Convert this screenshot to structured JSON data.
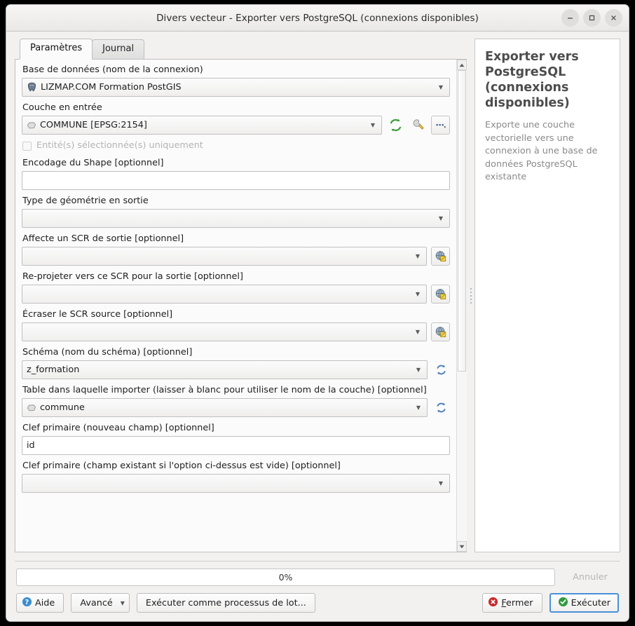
{
  "window": {
    "title": "Divers vecteur - Exporter vers PostgreSQL (connexions disponibles)",
    "minimize_label": "minimize-icon",
    "maximize_label": "maximize-icon",
    "close_label": "close-icon"
  },
  "tabs": [
    {
      "label": "Paramètres",
      "active": true
    },
    {
      "label": "Journal",
      "active": false
    }
  ],
  "form": {
    "database": {
      "label": "Base de données (nom de la connexion)",
      "value": "LIZMAP.COM Formation PostGIS",
      "icon": "postgresql-elephant-icon"
    },
    "input_layer": {
      "label": "Couche en entrée",
      "value": "COMMUNE [EPSG:2154]",
      "icon": "polygon-layer-icon",
      "buttons": [
        {
          "name": "iterate-icon",
          "glyph": "↻"
        },
        {
          "name": "wrench-icon",
          "glyph": "🔧"
        },
        {
          "name": "more-options-button",
          "label": "..."
        }
      ]
    },
    "selected_only": {
      "label": "Entité(s) sélectionnée(s) uniquement",
      "checked": false,
      "disabled": true
    },
    "shape_encoding": {
      "label": "Encodage du Shape [optionnel]",
      "value": ""
    },
    "geometry_type": {
      "label": "Type de géométrie en sortie",
      "value": ""
    },
    "assign_crs": {
      "label": "Affecte un SCR de sortie [optionnel]",
      "value": "",
      "button": "crs-select-icon"
    },
    "reproject_crs": {
      "label": "Re-projeter vers ce SCR pour la sortie [optionnel]",
      "value": "",
      "button": "crs-select-icon"
    },
    "override_crs": {
      "label": "Écraser le SCR source [optionnel]",
      "value": "",
      "button": "crs-select-icon"
    },
    "schema": {
      "label": "Schéma (nom du schéma) [optionnel]",
      "value": "z_formation",
      "button": "refresh-icon"
    },
    "table": {
      "label": "Table dans laquelle importer (laisser à blanc pour utiliser le nom de la couche) [optionnel]",
      "value": "commune",
      "icon": "polygon-layer-icon",
      "button": "refresh-icon"
    },
    "primary_key_new": {
      "label": "Clef primaire (nouveau champ) [optionnel]",
      "value": "id"
    },
    "primary_key_existing": {
      "label": "Clef primaire (champ existant si l'option ci-dessus est vide) [optionnel]",
      "value": ""
    }
  },
  "help": {
    "title": "Exporter vers PostgreSQL (connexions disponibles)",
    "description": "Exporte une couche vectorielle vers une connexion à une base de données PostgreSQL existante"
  },
  "bottom": {
    "progress_text": "0%",
    "progress_percent": 0,
    "cancel_label": "Annuler",
    "help_label": "Aide",
    "advanced_label": "Avancé",
    "batch_label": "Exécuter comme processus de lot...",
    "close_label": "Fermer",
    "run_label": "Exécuter"
  },
  "colors": {
    "accent_blue": "#4a90d9",
    "run_green": "#2e9b3f",
    "close_red": "#c92a2a",
    "help_blue": "#3a8ed0"
  }
}
